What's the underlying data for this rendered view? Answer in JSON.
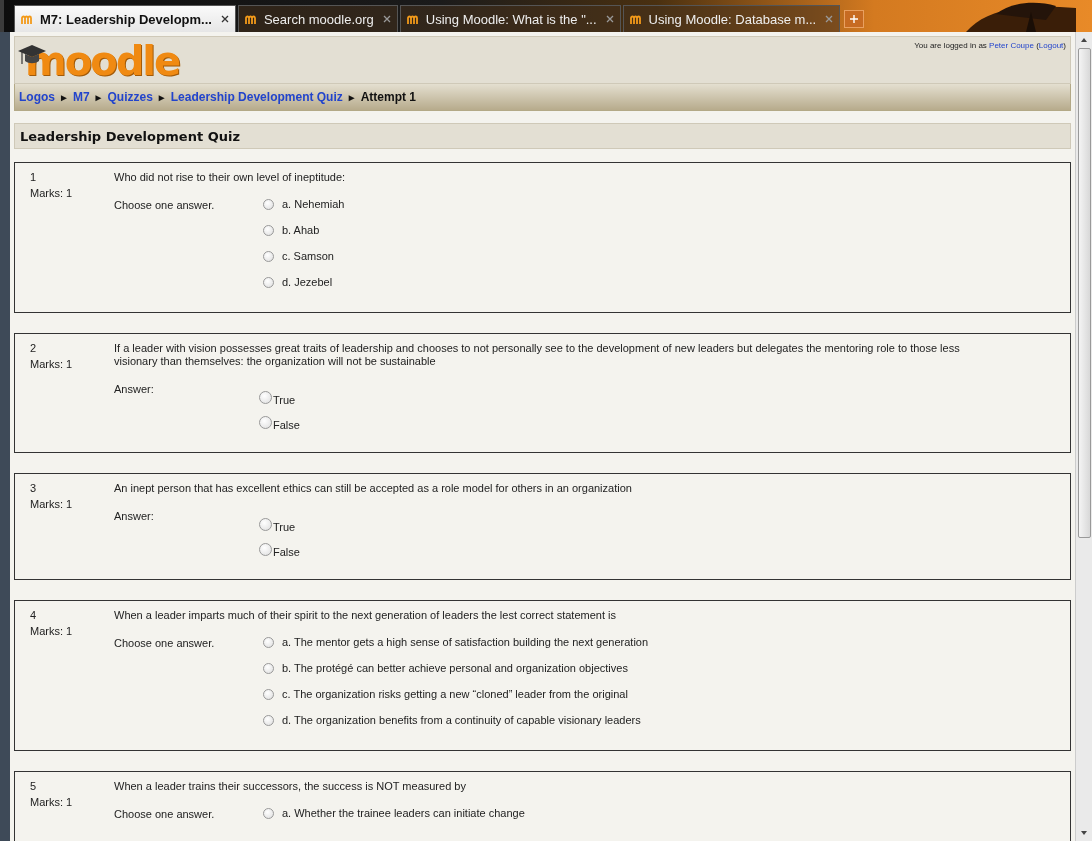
{
  "browser_tabs": [
    {
      "label": "M7: Leadership Developm...",
      "selected": true
    },
    {
      "label": "Search moodle.org",
      "selected": false
    },
    {
      "label": "Using Moodle: What is the \"...",
      "selected": false
    },
    {
      "label": "Using Moodle: Database m...",
      "selected": false
    }
  ],
  "header": {
    "logo": "moodle",
    "login": [
      {
        "text": "You are logged in as ",
        "kind": "plain"
      },
      {
        "text": "Peter Coupe",
        "kind": "link"
      },
      {
        "text": " (",
        "kind": "plain"
      },
      {
        "text": "Logout",
        "kind": "link"
      },
      {
        "text": ")",
        "kind": "plain"
      }
    ]
  },
  "breadcrumb": {
    "separator": "►",
    "items": [
      {
        "label": "Logos",
        "kind": "link"
      },
      {
        "label": "M7",
        "kind": "link"
      },
      {
        "label": "Quizzes",
        "kind": "link"
      },
      {
        "label": "Leadership Development Quiz",
        "kind": "link"
      },
      {
        "label": "Attempt 1",
        "kind": "current"
      }
    ]
  },
  "quiz_title": "Leadership Development Quiz",
  "questions": [
    {
      "number": "1",
      "marks": "Marks: 1",
      "text": "Who did not rise to their own level of ineptitude:",
      "prompt": "Choose one answer.",
      "kind": "multichoice",
      "options": [
        {
          "label": "a. Nehemiah",
          "selected": false
        },
        {
          "label": "b. Ahab",
          "selected": false
        },
        {
          "label": "c. Samson",
          "selected": false
        },
        {
          "label": "d. Jezebel",
          "selected": false
        }
      ]
    },
    {
      "number": "2",
      "marks": "Marks: 1",
      "text": "If a leader with vision possesses great traits of leadership and chooses to not personally see to the development of new leaders but delegates the mentoring role to those less visionary than themselves: the organization will not be sustainable",
      "prompt": "Answer:",
      "kind": "truefalse",
      "options": [
        {
          "label": "True",
          "selected": false
        },
        {
          "label": "False",
          "selected": false
        }
      ]
    },
    {
      "number": "3",
      "marks": "Marks: 1",
      "text": "An inept person that has excellent ethics can still be accepted as a role model for others in an organization",
      "prompt": "Answer:",
      "kind": "truefalse",
      "options": [
        {
          "label": "True",
          "selected": false
        },
        {
          "label": "False",
          "selected": false
        }
      ]
    },
    {
      "number": "4",
      "marks": "Marks: 1",
      "text": "When a leader imparts much of their spirit to the next generation of leaders the lest correct statement is",
      "prompt": "Choose one answer.",
      "kind": "multichoice",
      "options": [
        {
          "label": "a. The mentor gets a high sense of satisfaction building the next generation",
          "selected": false
        },
        {
          "label": "b. The protégé can better achieve personal and organization objectives",
          "selected": false
        },
        {
          "label": "c. The organization risks getting a new “cloned” leader from the original",
          "selected": false
        },
        {
          "label": "d. The organization benefits from a continuity of capable visionary leaders",
          "selected": false
        }
      ]
    },
    {
      "number": "5",
      "marks": "Marks: 1",
      "text": "When a leader trains their successors, the success is NOT measured by",
      "prompt": "Choose one answer.",
      "kind": "multichoice",
      "options": [
        {
          "label": "a. Whether the trainee leaders can initiate change",
          "selected": false
        }
      ]
    }
  ]
}
